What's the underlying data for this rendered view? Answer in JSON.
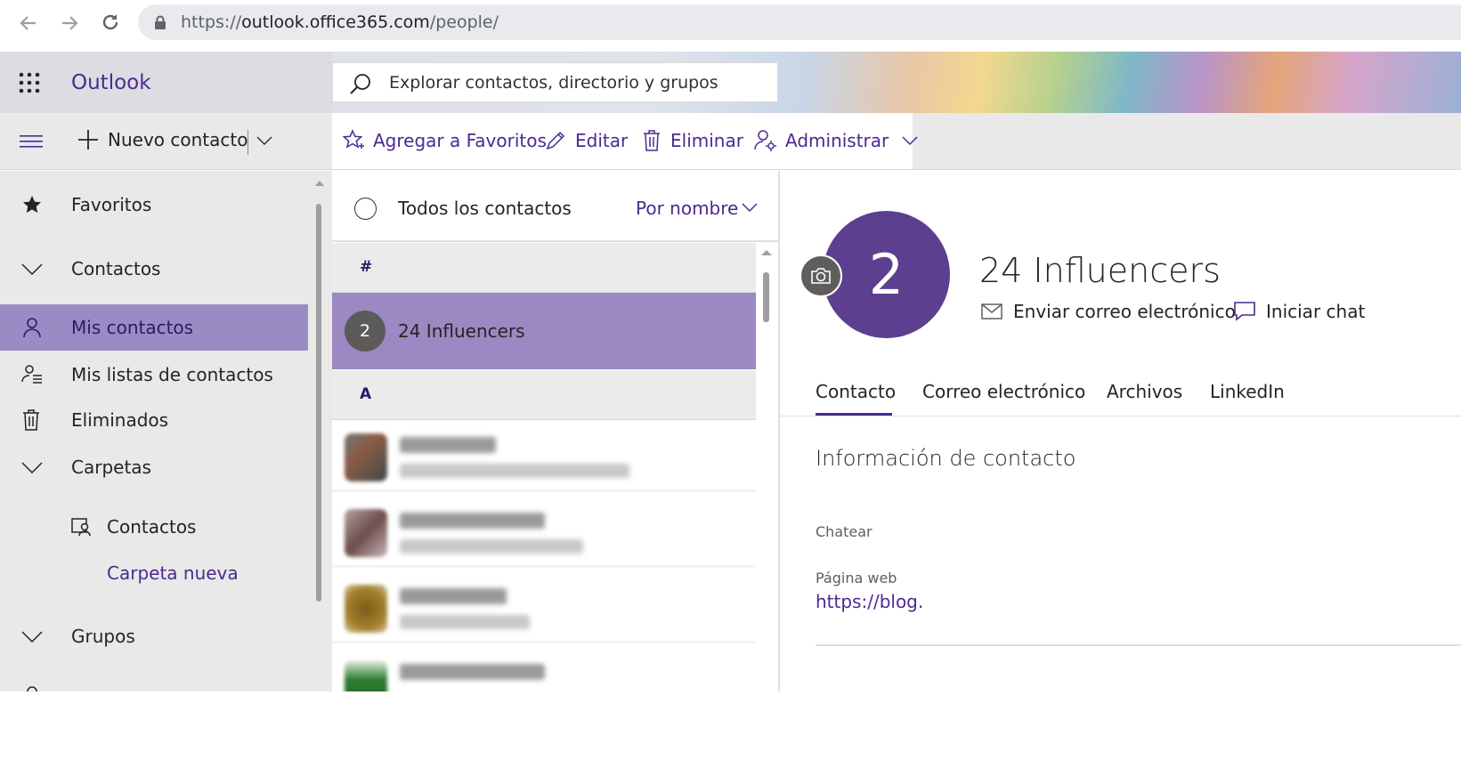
{
  "browser": {
    "url_prefix": "https://",
    "url_host": "outlook.office365.com",
    "url_path": "/people/"
  },
  "header": {
    "app_name": "Outlook",
    "search_placeholder": "Explorar contactos, directorio y grupos"
  },
  "toolbar": {
    "new_contact": "Nuevo contacto",
    "add_favorites": "Agregar a Favoritos",
    "edit": "Editar",
    "delete": "Eliminar",
    "manage": "Administrar"
  },
  "sidebar": {
    "favorites": "Favoritos",
    "contacts": "Contactos",
    "my_contacts": "Mis contactos",
    "my_lists": "Mis listas de contactos",
    "deleted": "Eliminados",
    "folders": "Carpetas",
    "folder_contacts": "Contactos",
    "new_folder": "Carpeta nueva",
    "groups": "Grupos"
  },
  "list": {
    "title": "Todos los contactos",
    "sort": "Por nombre",
    "groups": [
      "#",
      "A"
    ],
    "selected_contact": {
      "initial": "2",
      "name": "24 Influencers"
    }
  },
  "detail": {
    "initial": "2",
    "name": "24 Influencers",
    "send_email": "Enviar correo electrónico",
    "start_chat": "Iniciar chat",
    "tabs": [
      "Contacto",
      "Correo electrónico",
      "Archivos",
      "LinkedIn"
    ],
    "active_tab": "Contacto",
    "section_title": "Información de contacto",
    "chat_label": "Chatear",
    "web_label": "Página web",
    "web_value": "https://blog."
  },
  "colors": {
    "accent": "#4b2a91",
    "selected_bg": "#9b8bc5",
    "avatar_bg": "#5c3f8e"
  }
}
